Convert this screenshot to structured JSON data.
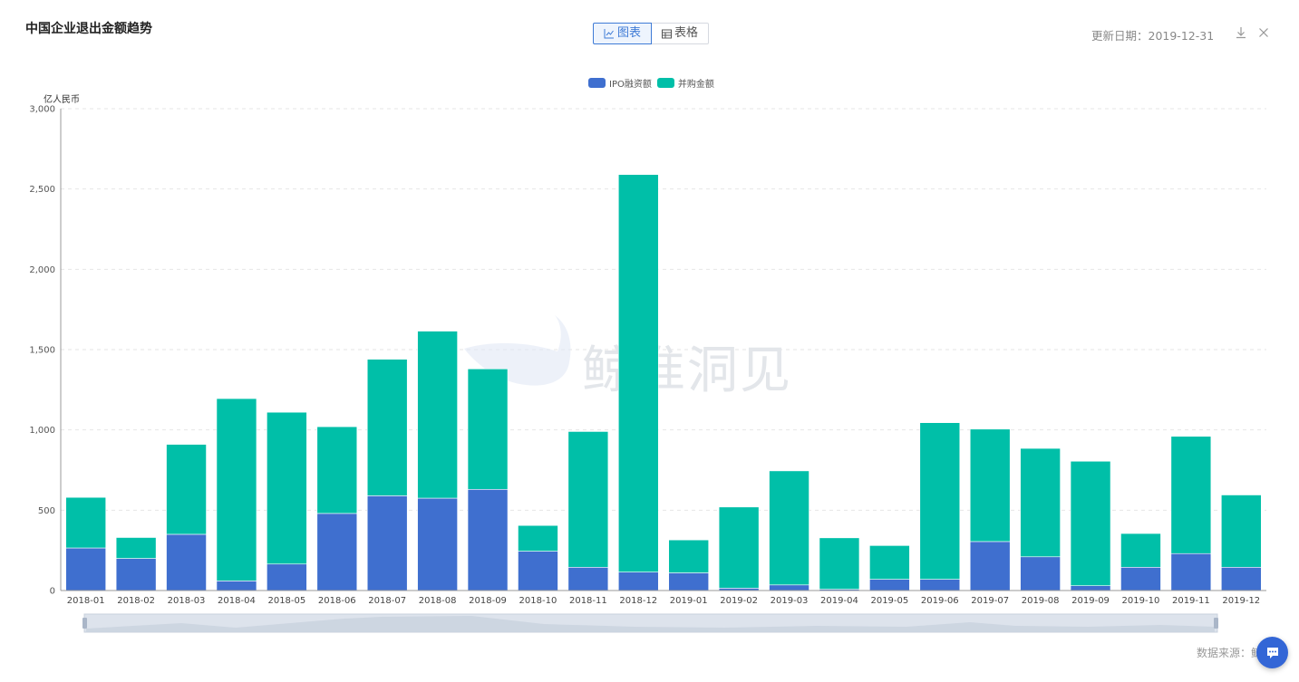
{
  "header": {
    "title": "中国企业退出金额趋势",
    "tab_chart": "图表",
    "tab_table": "表格",
    "update_label": "更新日期：2019-12-31"
  },
  "icons": {
    "chart_tab": "line-chart-icon",
    "table_tab": "table-icon",
    "download": "download-icon",
    "close": "close-icon",
    "chat": "chat-icon",
    "watermark": "whale-logo"
  },
  "watermark_text": "鲸准洞见",
  "footer": {
    "source_label": "数据来源：鲸"
  },
  "colors": {
    "ipo": "#3f6fcf",
    "ma": "#00bfa8",
    "accent": "#3f7bd6"
  },
  "chart_data": {
    "type": "bar",
    "stacked": true,
    "title": "",
    "ylabel": "亿人民币",
    "xlabel": "",
    "ylim": [
      0,
      3000
    ],
    "yticks": [
      0,
      500,
      1000,
      1500,
      2000,
      2500,
      3000
    ],
    "ytick_labels": [
      "0",
      "500",
      "1,000",
      "1,500",
      "2,000",
      "2,500",
      "3,000"
    ],
    "grid": true,
    "legend_position": "top-center",
    "categories": [
      "2018-01",
      "2018-02",
      "2018-03",
      "2018-04",
      "2018-05",
      "2018-06",
      "2018-07",
      "2018-08",
      "2018-09",
      "2018-10",
      "2018-11",
      "2018-12",
      "2019-01",
      "2019-02",
      "2019-03",
      "2019-04",
      "2019-05",
      "2019-06",
      "2019-07",
      "2019-08",
      "2019-09",
      "2019-10",
      "2019-11",
      "2019-12"
    ],
    "series": [
      {
        "name": "IPO融资额",
        "color": "#3f6fcf",
        "values": [
          265,
          200,
          350,
          60,
          165,
          480,
          590,
          575,
          630,
          245,
          145,
          115,
          110,
          15,
          35,
          8,
          70,
          70,
          305,
          210,
          30,
          145,
          230,
          145
        ]
      },
      {
        "name": "并购金额",
        "color": "#00bfa8",
        "values": [
          315,
          130,
          560,
          1135,
          945,
          540,
          850,
          1040,
          750,
          160,
          845,
          2475,
          205,
          505,
          710,
          320,
          210,
          975,
          700,
          675,
          775,
          210,
          730,
          450
        ]
      }
    ]
  }
}
